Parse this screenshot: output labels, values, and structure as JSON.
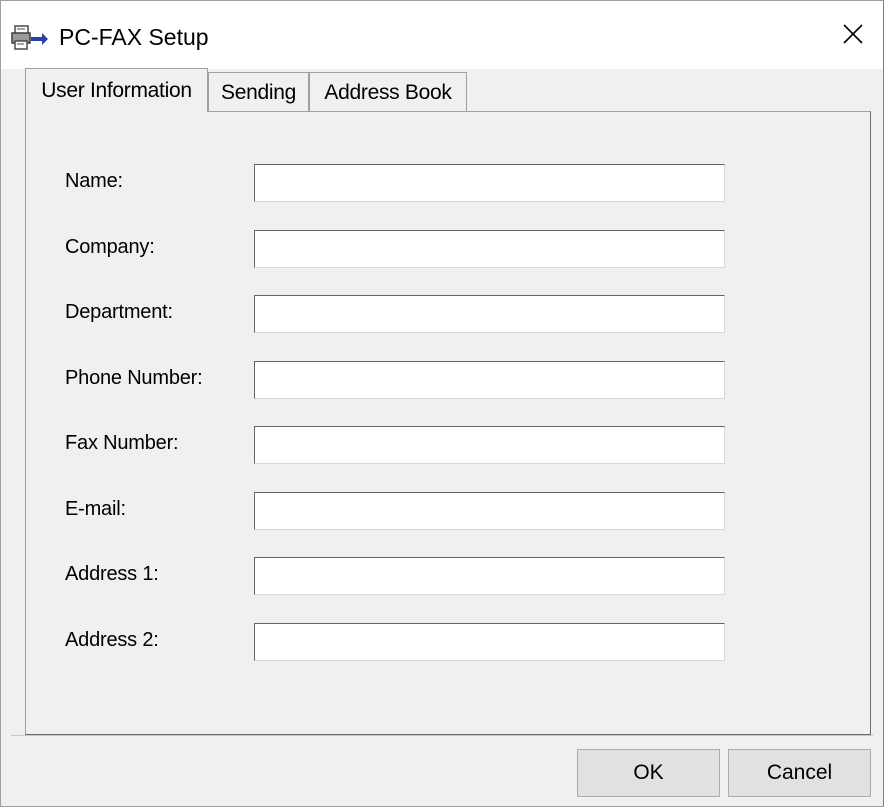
{
  "window": {
    "title": "PC-FAX Setup",
    "icon": "pc-fax-icon",
    "close_icon": "close-icon"
  },
  "tabs": [
    {
      "label": "User Information",
      "active": true
    },
    {
      "label": "Sending",
      "active": false
    },
    {
      "label": "Address Book",
      "active": false
    }
  ],
  "form": {
    "fields": [
      {
        "label": "Name:",
        "value": ""
      },
      {
        "label": "Company:",
        "value": ""
      },
      {
        "label": "Department:",
        "value": ""
      },
      {
        "label": "Phone Number:",
        "value": ""
      },
      {
        "label": "Fax Number:",
        "value": ""
      },
      {
        "label": "E-mail:",
        "value": ""
      },
      {
        "label": "Address 1:",
        "value": ""
      },
      {
        "label": "Address 2:",
        "value": ""
      }
    ]
  },
  "buttons": {
    "ok_label": "OK",
    "cancel_label": "Cancel"
  },
  "colors": {
    "window_bg": "#f0f0f0",
    "titlebar_bg": "#ffffff",
    "button_bg": "#e1e1e1",
    "icon_accent": "#2c3fa8"
  }
}
